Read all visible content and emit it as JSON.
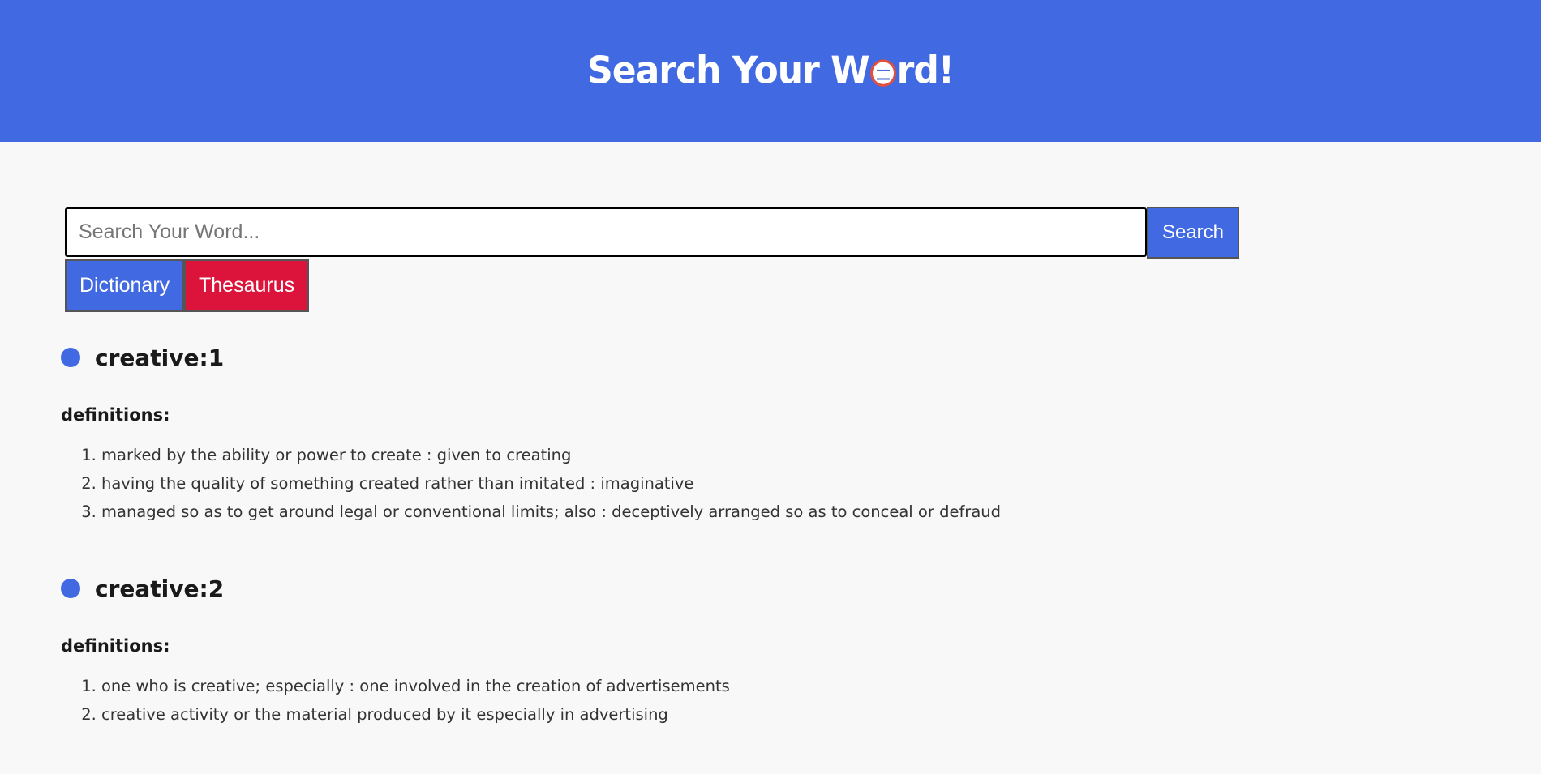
{
  "header": {
    "title_before": "Search Your W",
    "title_after": "rd!",
    "logo_icon": "merriam-webster-seal-icon"
  },
  "search": {
    "placeholder": "Search Your Word...",
    "value": "",
    "button_label": "Search"
  },
  "modes": {
    "dictionary_label": "Dictionary",
    "thesaurus_label": "Thesaurus"
  },
  "results": [
    {
      "word": "creative:1",
      "definitions_label": "definitions:",
      "definitions": [
        "marked by the ability or power to create : given to creating",
        "having the quality of something created rather than imitated : imaginative",
        "managed so as to get around legal or conventional limits; also : deceptively arranged so as to conceal or defraud"
      ]
    },
    {
      "word": "creative:2",
      "definitions_label": "definitions:",
      "definitions": [
        "one who is creative; especially : one involved in the creation of advertisements",
        "creative activity or the material produced by it especially in advertising"
      ]
    }
  ],
  "colors": {
    "primary": "#4169e1",
    "thesaurus": "#dc143c",
    "background": "#f8f8f8"
  }
}
